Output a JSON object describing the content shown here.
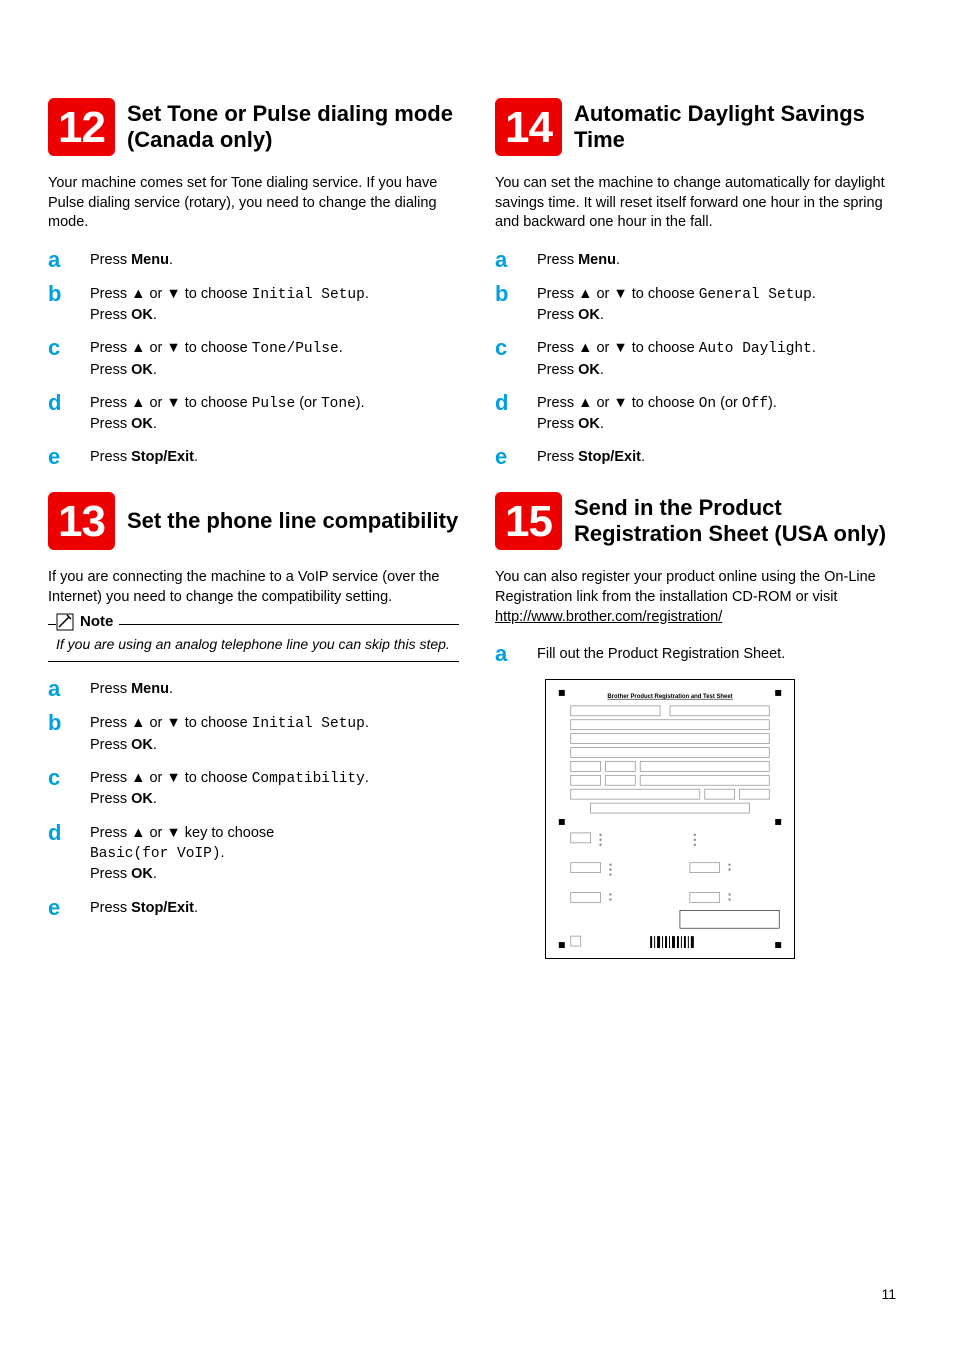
{
  "left": {
    "s12": {
      "num": "12",
      "title": "Set Tone or Pulse dialing mode\n(Canada only)",
      "intro": "Your machine comes set for Tone dialing service. If you have Pulse dialing service (rotary), you need to change the dialing mode.",
      "steps": {
        "a": {
          "press": "Press ",
          "bold": "Menu",
          "after": "."
        },
        "b": {
          "pre": "Press ▲ or ▼ to choose ",
          "mono": "Initial Setup",
          "after": ".",
          "line2pre": "Press ",
          "line2bold": "OK",
          "line2after": "."
        },
        "c": {
          "pre": "Press ▲ or ▼ to choose ",
          "mono": "Tone/Pulse",
          "after": ".",
          "line2pre": "Press ",
          "line2bold": "OK",
          "line2after": "."
        },
        "d": {
          "pre": "Press ▲ or ▼ to choose ",
          "mono1": "Pulse",
          "mid": " (or ",
          "mono2": "Tone",
          "after": ").",
          "line2pre": "Press ",
          "line2bold": "OK",
          "line2after": "."
        },
        "e": {
          "press": "Press ",
          "bold": "Stop/Exit",
          "after": "."
        }
      }
    },
    "s13": {
      "num": "13",
      "title": "Set the phone line compatibility",
      "intro": "If you are connecting the machine to a VoIP service (over the Internet) you need to change the compatibility setting.",
      "note_label": "Note",
      "note_text": "If you are using an analog telephone line you can skip this step.",
      "steps": {
        "a": {
          "press": "Press ",
          "bold": "Menu",
          "after": "."
        },
        "b": {
          "pre": "Press ▲ or ▼ to choose ",
          "mono": "Initial Setup",
          "after": ".",
          "line2pre": "Press ",
          "line2bold": "OK",
          "line2after": "."
        },
        "c": {
          "pre": "Press ▲ or ▼ to choose ",
          "mono": "Compatibility",
          "after": ".",
          "line2pre": "Press ",
          "line2bold": "OK",
          "line2after": "."
        },
        "d": {
          "pre": "Press ▲ or ▼ key to choose ",
          "mono": "Basic(for VoIP)",
          "after": ".",
          "line2pre": "Press ",
          "line2bold": "OK",
          "line2after": "."
        },
        "e": {
          "press": "Press ",
          "bold": "Stop/Exit",
          "after": "."
        }
      }
    }
  },
  "right": {
    "s14": {
      "num": "14",
      "title": "Automatic Daylight Savings Time",
      "intro": "You can set the machine to change automatically for daylight savings time. It will reset itself forward one hour in the spring and backward one hour in the fall.",
      "steps": {
        "a": {
          "press": "Press ",
          "bold": "Menu",
          "after": "."
        },
        "b": {
          "pre": "Press ▲ or ▼ to choose ",
          "mono": "General Setup",
          "after": ".",
          "line2pre": "Press ",
          "line2bold": "OK",
          "line2after": "."
        },
        "c": {
          "pre": "Press ▲ or ▼ to choose ",
          "mono": "Auto Daylight",
          "after": ".",
          "line2pre": "Press ",
          "line2bold": "OK",
          "line2after": "."
        },
        "d": {
          "pre": "Press ▲ or ▼ to choose ",
          "mono1": "On",
          "mid": " (or ",
          "mono2": "Off",
          "after": ").",
          "line2pre": "Press ",
          "line2bold": "OK",
          "line2after": "."
        },
        "e": {
          "press": "Press ",
          "bold": "Stop/Exit",
          "after": "."
        }
      }
    },
    "s15": {
      "num": "15",
      "title": "Send in the Product Registration Sheet (USA only)",
      "intro_pre": "You can also register your product online using the On-Line Registration link from the installation CD-ROM or visit ",
      "intro_link": "http://www.brother.com/registration/",
      "steps": {
        "a": {
          "text": "Fill out the Product Registration Sheet."
        }
      },
      "form_title": "Brother Product Registration and Test Sheet"
    }
  },
  "page_number": "11"
}
